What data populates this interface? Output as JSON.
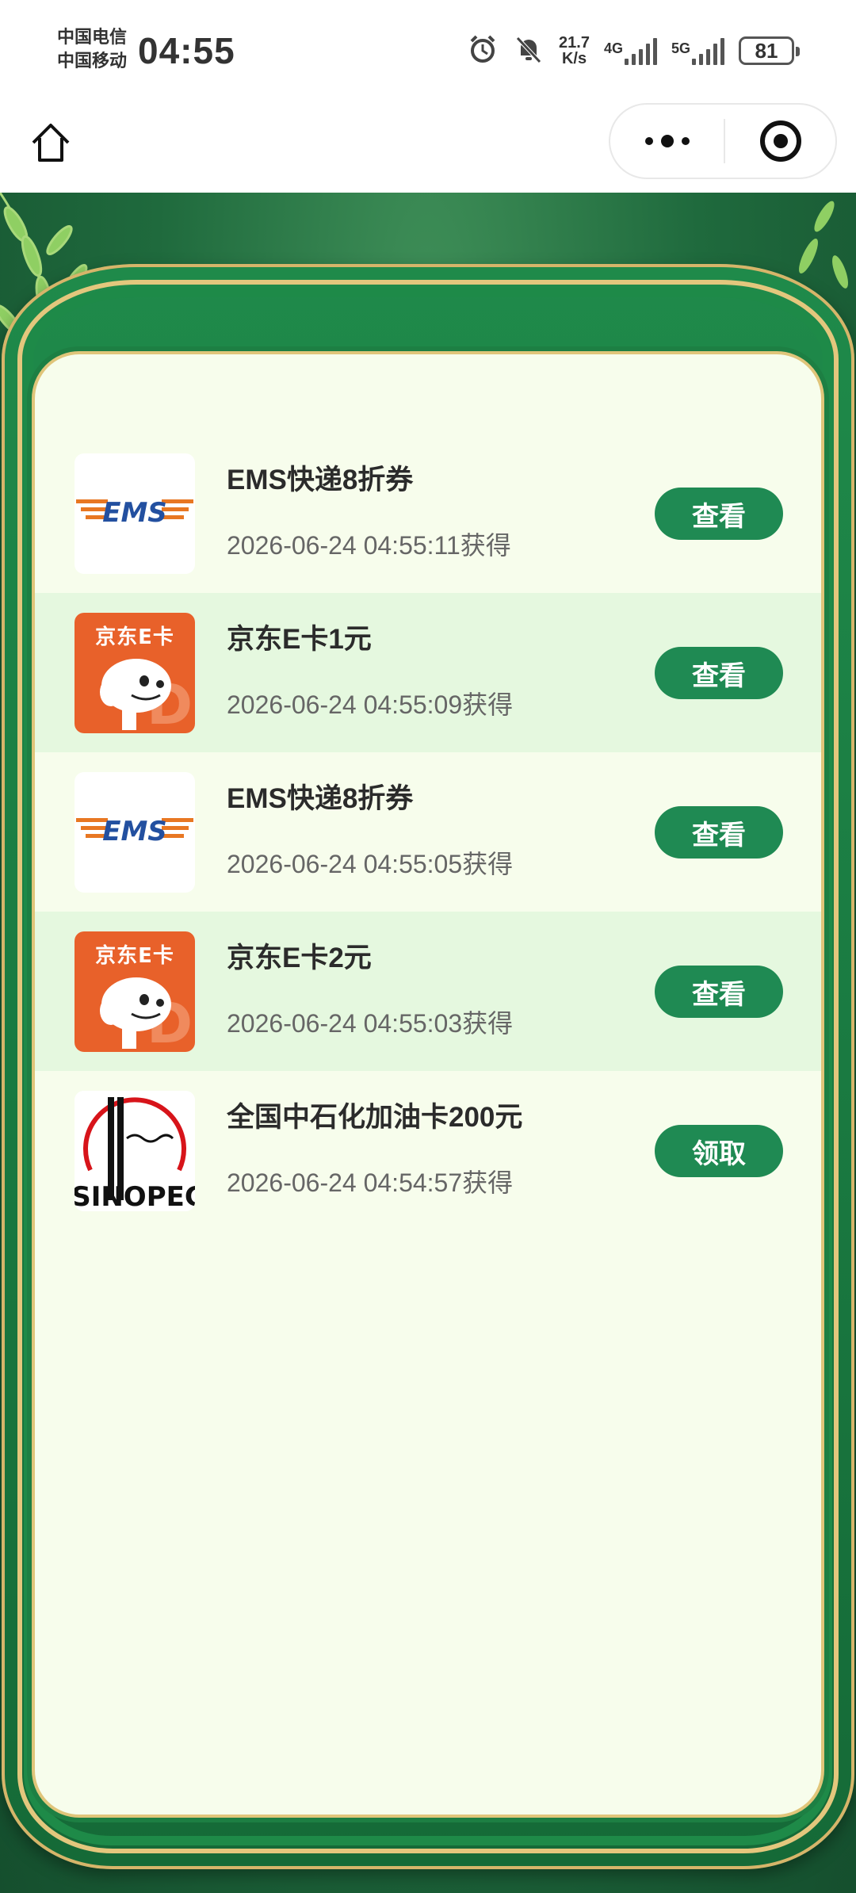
{
  "status_bar": {
    "carrier_1": "中国电信",
    "carrier_2": "中国移动",
    "time": "04:55",
    "speed_value": "21.7",
    "speed_unit": "K/s",
    "net_1": "4G",
    "net_2": "5G",
    "battery": "81"
  },
  "colors": {
    "accent_green": "#1f8a53",
    "panel_bg": "#f7fdec",
    "alt_row_bg": "#e5f8df",
    "frame_gold": "#e0c57a",
    "jd_orange": "#e8612a"
  },
  "items": [
    {
      "logo": "ems-logo",
      "title": "EMS快递8折券",
      "time": "2026-06-24 04:55:11获得",
      "action": "查看"
    },
    {
      "logo": "jd-ecard-logo",
      "logo_text": "京东E卡",
      "title": "京东E卡1元",
      "time": "2026-06-24 04:55:09获得",
      "action": "查看"
    },
    {
      "logo": "ems-logo",
      "title": "EMS快递8折券",
      "time": "2026-06-24 04:55:05获得",
      "action": "查看"
    },
    {
      "logo": "jd-ecard-logo",
      "logo_text": "京东E卡",
      "title": "京东E卡2元",
      "time": "2026-06-24 04:55:03获得",
      "action": "查看"
    },
    {
      "logo": "sinopec-logo",
      "title": "全国中石化加油卡200元",
      "time": "2026-06-24 04:54:57获得",
      "action": "领取"
    }
  ]
}
